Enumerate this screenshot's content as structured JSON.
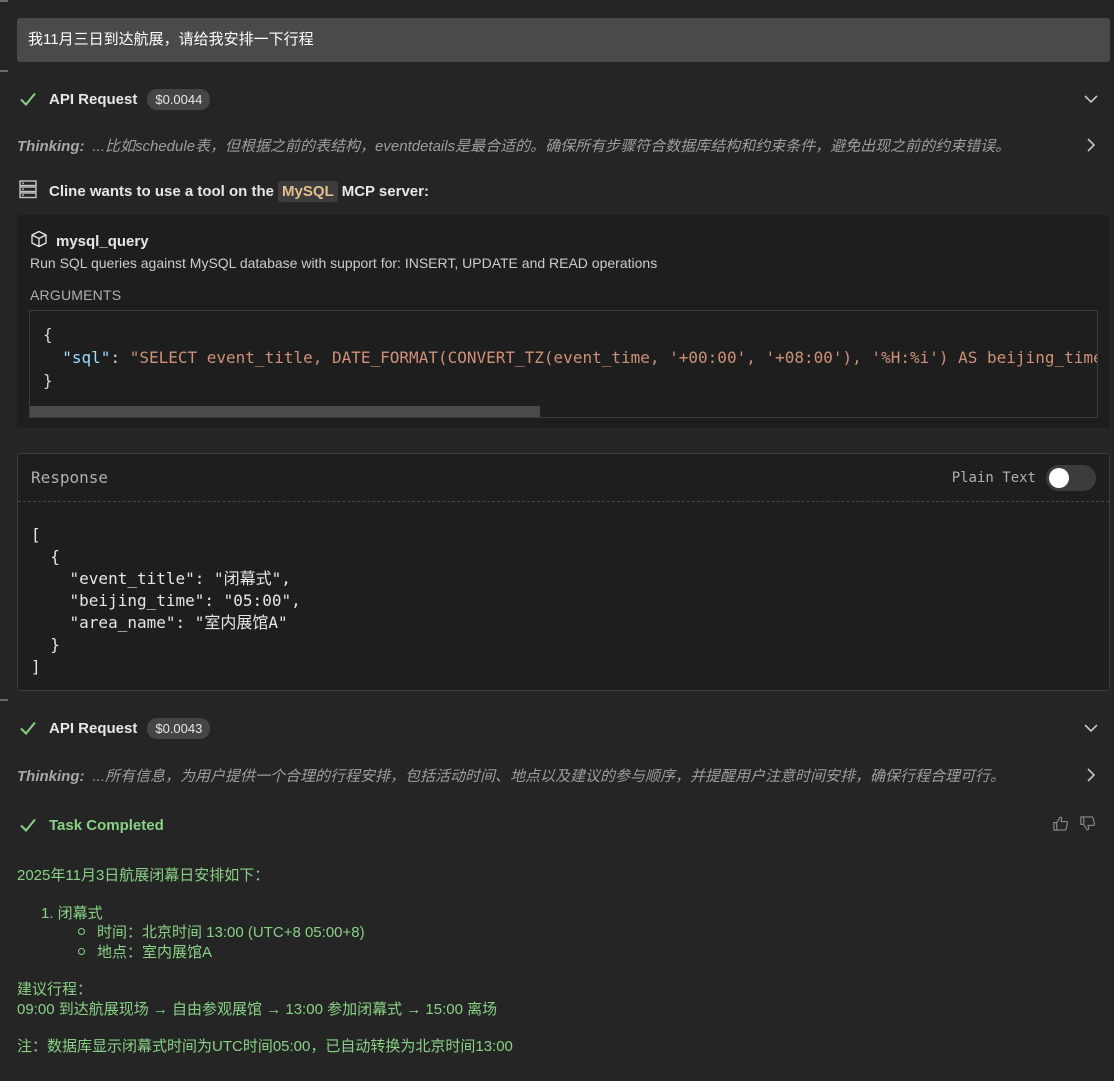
{
  "user_message": "我11月三日到达航展，请给我安排一下行程",
  "api_request_1": {
    "title": "API Request",
    "cost": "$0.0044"
  },
  "thinking_1": {
    "label": "Thinking:",
    "text": "...比如schedule表，但根据之前的表结构，eventdetails是最合适的。确保所有步骤符合数据库结构和约束条件，避免出现之前的约束错误。"
  },
  "tool_use": {
    "prefix": "Cline wants to use a tool on the",
    "server": "MySQL",
    "suffix": "MCP server:",
    "tool_name": "mysql_query",
    "description": "Run SQL queries against MySQL database with support for: INSERT, UPDATE and READ operations",
    "arguments_label": "ARGUMENTS",
    "args_open": "{",
    "arg_key": "\"sql\"",
    "arg_value": "\"SELECT event_title, DATE_FORMAT(CONVERT_TZ(event_time, '+00:00', '+08:00'), '%H:%i') AS beijing_time",
    "args_close": "}"
  },
  "response": {
    "title": "Response",
    "plain_text_label": "Plain Text",
    "body": "[\n  {\n    \"event_title\": \"闭幕式\",\n    \"beijing_time\": \"05:00\",\n    \"area_name\": \"室内展馆A\"\n  }\n]"
  },
  "api_request_2": {
    "title": "API Request",
    "cost": "$0.0043"
  },
  "thinking_2": {
    "label": "Thinking:",
    "text": "...所有信息，为用户提供一个合理的行程安排，包括活动时间、地点以及建议的参与顺序，并提醒用户注意时间安排，确保行程合理可行。"
  },
  "task": {
    "title": "Task Completed",
    "intro": "2025年11月3日航展闭幕日安排如下：",
    "item_1": "1. 闭幕式",
    "item_1_time": "时间：北京时间 13:00 (UTC+8 05:00+8)",
    "item_1_place": "地点：室内展馆A",
    "suggest_label": "建议行程：",
    "suggest_text": "09:00 到达航展现场 → 自由参观展馆 → 13:00 参加闭幕式 → 15:00 离场",
    "note": "注：数据库显示闭幕式时间为UTC时间05:00，已自动转换为北京时间13:00"
  },
  "colors": {
    "accent_green": "#89d185",
    "mysql_pill_text": "#e2c08d",
    "json_key": "#9cdcfe",
    "json_string": "#ce9178"
  },
  "icons": [
    "check-icon",
    "chevron-down-icon",
    "chevron-right-icon",
    "server-icon",
    "cube-icon",
    "thumbs-up-icon",
    "thumbs-down-icon"
  ]
}
